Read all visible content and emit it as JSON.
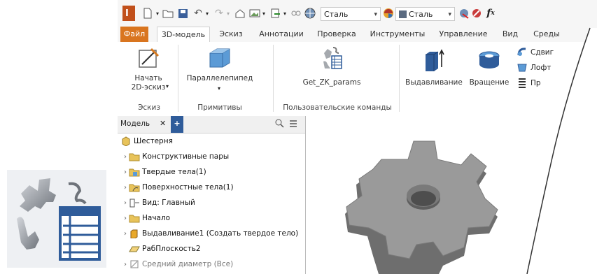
{
  "qat": {
    "material_combo": "Сталь",
    "appearance_combo": "Сталь",
    "fx_label": "f"
  },
  "tabs": [
    {
      "label": "Файл"
    },
    {
      "label": "3D-модель"
    },
    {
      "label": "Эскиз"
    },
    {
      "label": "Аннотации"
    },
    {
      "label": "Проверка"
    },
    {
      "label": "Инструменты"
    },
    {
      "label": "Управление"
    },
    {
      "label": "Вид"
    },
    {
      "label": "Среды"
    }
  ],
  "ribbon": {
    "start_sketch_line1": "Начать",
    "start_sketch_line2": "2D-эскиз",
    "box": "Параллелепипед",
    "get_params": "Get_ZK_params",
    "extrude": "Выдавливание",
    "revolve": "Вращение",
    "sweep": "Сдвиг",
    "loft": "Лофт",
    "coil": "Пр",
    "groups": {
      "sketch": "Эскиз",
      "primitives": "Примитивы",
      "user_commands": "Пользовательские команды"
    }
  },
  "panel": {
    "tab_label": "Модель",
    "close": "✕",
    "add": "+",
    "tree": [
      {
        "label": "Шестерня"
      },
      {
        "label": "Конструктивные пары"
      },
      {
        "label": "Твердые тела(1)"
      },
      {
        "label": "Поверхностные тела(1)"
      },
      {
        "label": "Вид: Главный"
      },
      {
        "label": "Начало"
      },
      {
        "label": "Выдавливание1 (Создать твердое тело)"
      },
      {
        "label": "РабПлоскость2"
      },
      {
        "label": "Средний диаметр (Все)"
      }
    ]
  },
  "colors": {
    "file_tab": "#d9751f",
    "gear": "#8a8a8a",
    "folder": "#e8c35a"
  }
}
